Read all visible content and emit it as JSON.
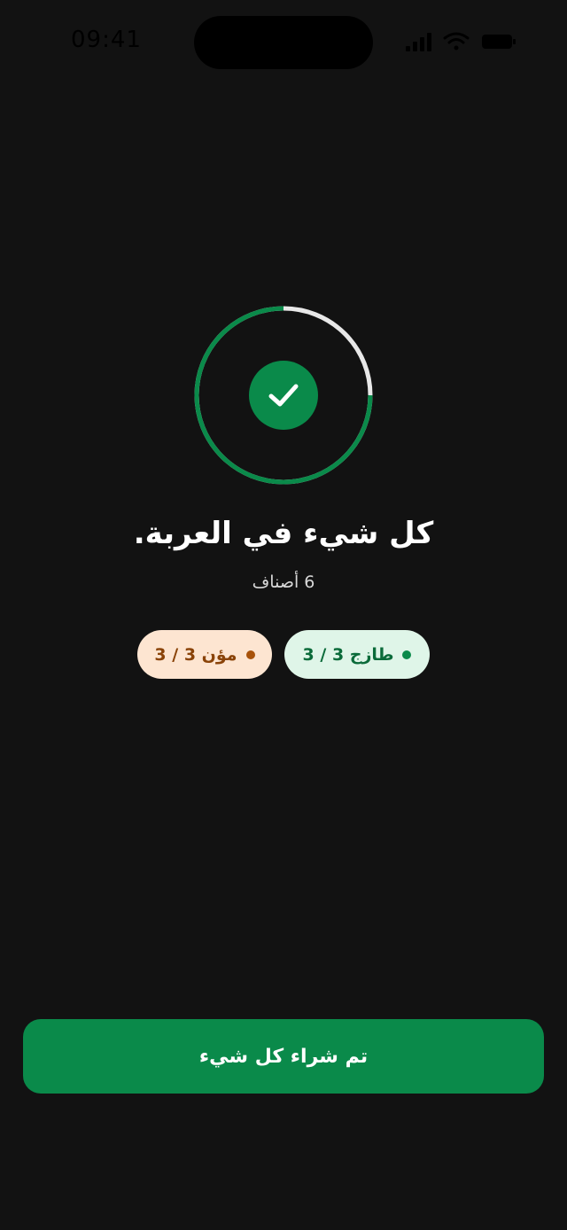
{
  "status_bar": {
    "time": "09:41",
    "icons": [
      "cellular-signal-icon",
      "wifi-icon",
      "battery-icon"
    ]
  },
  "progress": {
    "value": 0.75,
    "accent_color": "#0a8a4a",
    "track_color": "#e8e8e8",
    "icon": "checkmark-icon"
  },
  "summary": {
    "title": "كل شيء في العربة.",
    "subtitle": "6 أصناف"
  },
  "chips": [
    {
      "label": "طازج 3 / 3",
      "color": "#0b6b3a",
      "background": "#dff5e8"
    },
    {
      "label": "مؤن 3 / 3",
      "color": "#8a4308",
      "background": "#fde5d1"
    }
  ],
  "footer": {
    "cta_label": "تم شراء كل شيء"
  }
}
